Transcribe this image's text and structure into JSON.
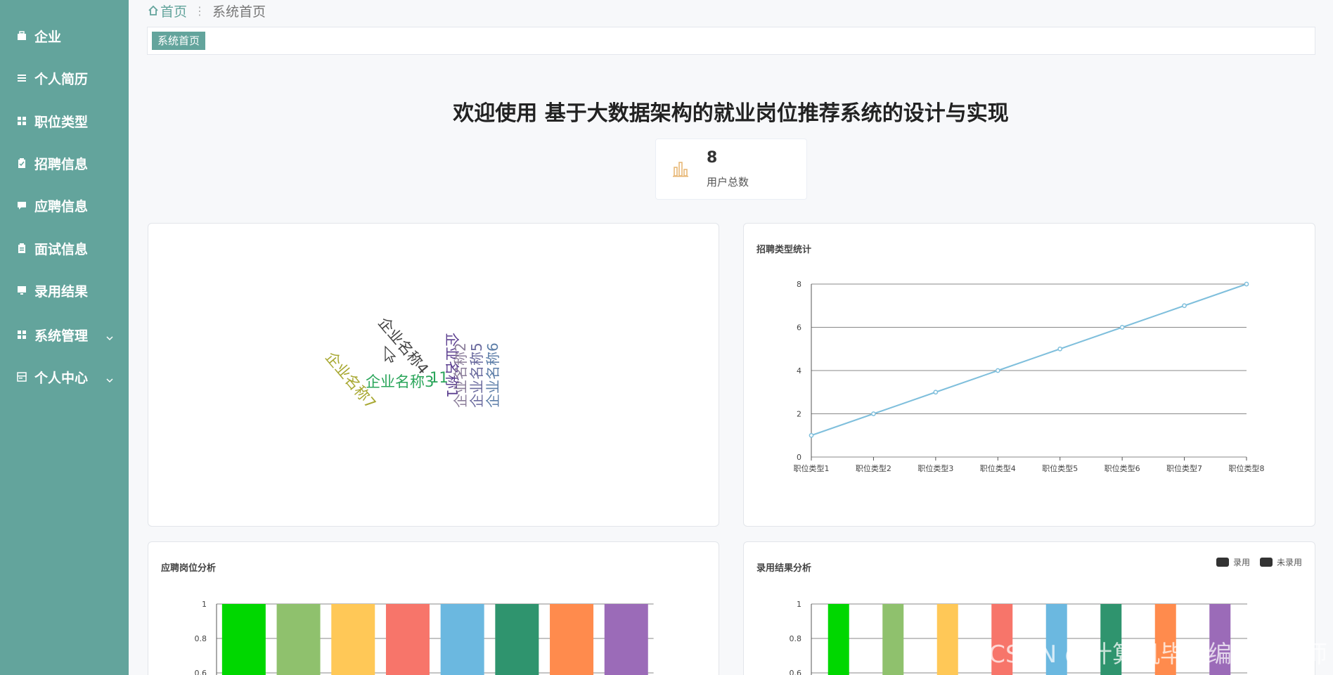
{
  "sidebar": {
    "items": [
      {
        "label": "企业",
        "icon": "briefcase-icon"
      },
      {
        "label": "个人简历",
        "icon": "list-icon"
      },
      {
        "label": "职位类型",
        "icon": "grid-icon"
      },
      {
        "label": "招聘信息",
        "icon": "clipboard-icon"
      },
      {
        "label": "应聘信息",
        "icon": "chat-icon"
      },
      {
        "label": "面试信息",
        "icon": "document-icon"
      },
      {
        "label": "录用结果",
        "icon": "monitor-icon"
      },
      {
        "label": "系统管理",
        "icon": "grid-icon"
      },
      {
        "label": "个人中心",
        "icon": "user-card-icon"
      }
    ]
  },
  "breadcrumb": {
    "home": "首页",
    "current": "系统首页"
  },
  "tabs": {
    "active": "系统首页"
  },
  "welcome": "欢迎使用 基于大数据架构的就业岗位推荐系统的设计与实现",
  "stat": {
    "value": "8",
    "label": "用户总数"
  },
  "wordcloud": {
    "words": [
      {
        "text": "企业名称4",
        "color": "#444444"
      },
      {
        "text": "企业名称7",
        "color": "#a8a832"
      },
      {
        "text": "企业名称3",
        "color": "#2aa55a"
      },
      {
        "text": "11",
        "color": "#2aa55a"
      },
      {
        "text": "企业名称1",
        "color": "#5b3e8f"
      },
      {
        "text": "企业名称2",
        "color": "#8a7c99"
      },
      {
        "text": "企业名称5",
        "color": "#6a6a9e"
      },
      {
        "text": "企业名称6",
        "color": "#5d7ea8"
      }
    ]
  },
  "charts": [
    {
      "type": "line",
      "title": "招聘类型统计",
      "categories": [
        "职位类型1",
        "职位类型2",
        "职位类型3",
        "职位类型4",
        "职位类型5",
        "职位类型6",
        "职位类型7",
        "职位类型8"
      ],
      "values": [
        1,
        2,
        3,
        4,
        5,
        6,
        7,
        8
      ],
      "ylim": [
        0,
        8
      ],
      "yticks": [
        0,
        2,
        4,
        6,
        8
      ],
      "color": "#7fbfdc"
    },
    {
      "type": "bar",
      "title": "应聘岗位分析",
      "values": [
        1,
        1,
        1,
        1,
        1,
        1,
        1,
        1
      ],
      "yticks": [
        "1",
        "0.8",
        "0.6"
      ],
      "colors": [
        "#00d700",
        "#8fc16d",
        "#ffc857",
        "#f7756a",
        "#6bb8e0",
        "#2f946e",
        "#ff8b4d",
        "#9b6bb8"
      ]
    },
    {
      "type": "bar",
      "title": "录用结果分析",
      "values": [
        1,
        1,
        1,
        1,
        1,
        1,
        1,
        1
      ],
      "yticks": [
        "1",
        "0.8",
        "0.6"
      ],
      "colors": [
        "#00d700",
        "#8fc16d",
        "#ffc857",
        "#f7756a",
        "#6bb8e0",
        "#2f946e",
        "#ff8b4d",
        "#9b6bb8"
      ],
      "legend": [
        "录用",
        "未录用"
      ]
    }
  ],
  "watermark": "CSDN @计算机毕设编程指导师"
}
